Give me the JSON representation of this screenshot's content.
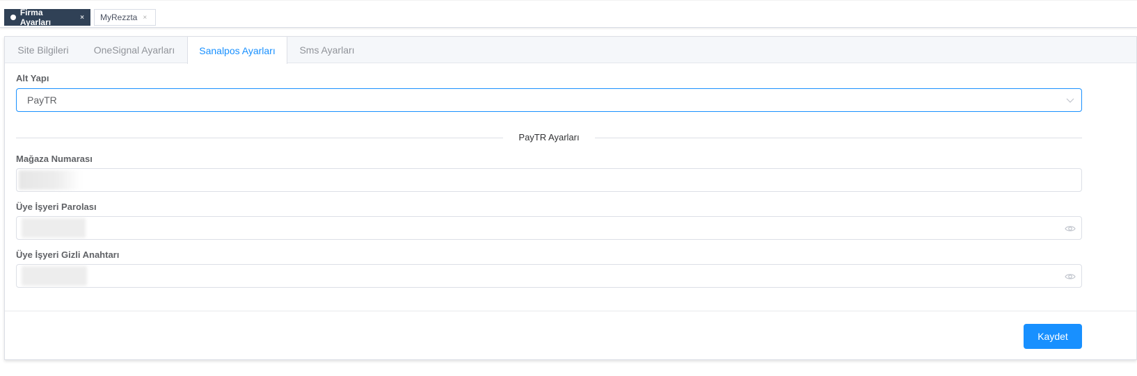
{
  "tags": [
    {
      "label": "Firma Ayarları",
      "close": "×",
      "active": true
    },
    {
      "label": "MyRezzta",
      "close": "×",
      "active": false
    }
  ],
  "tabs": [
    {
      "label": "Site Bilgileri"
    },
    {
      "label": "OneSignal Ayarları"
    },
    {
      "label": "Sanalpos Ayarları",
      "active": true
    },
    {
      "label": "Sms Ayarları"
    }
  ],
  "form": {
    "provider_label": "Alt Yapı",
    "provider_value": "PayTR",
    "section_title": "PayTR Ayarları",
    "store_number_label": "Mağaza Numarası",
    "merchant_password_label": "Üye İşyeri Parolası",
    "merchant_secret_label": "Üye İşyeri Gizli Anahtarı"
  },
  "footer": {
    "save_label": "Kaydet"
  },
  "colors": {
    "primary": "#1890ff",
    "tag_active": "#304156"
  },
  "icons": {
    "select": "chevron-down-icon",
    "password_toggle": "eye-icon",
    "tag_close": "close-icon"
  }
}
